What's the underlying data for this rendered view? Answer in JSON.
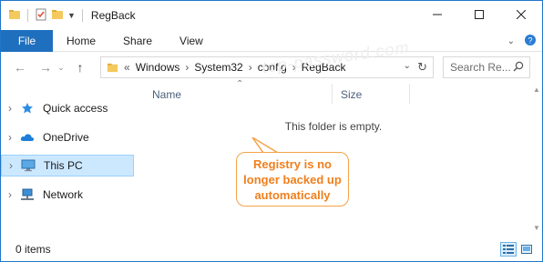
{
  "window": {
    "title": "RegBack"
  },
  "ribbon": {
    "tabs": [
      "File",
      "Home",
      "Share",
      "View"
    ]
  },
  "address": {
    "overflow": "«",
    "crumbs": [
      "Windows",
      "System32",
      "config",
      "RegBack"
    ]
  },
  "search": {
    "placeholder": "Search Re..."
  },
  "navpane": {
    "items": [
      {
        "label": "Quick access",
        "icon": "star-icon"
      },
      {
        "label": "OneDrive",
        "icon": "cloud-icon"
      },
      {
        "label": "This PC",
        "icon": "computer-icon",
        "selected": true
      },
      {
        "label": "Network",
        "icon": "network-icon"
      }
    ]
  },
  "content": {
    "columns": [
      "Name",
      "Size"
    ],
    "empty_message": "This folder is empty."
  },
  "callout": {
    "text": "Registry is no longer backed up automatically"
  },
  "watermark": {
    "text": "top-password.com"
  },
  "status": {
    "items": "0 items"
  },
  "colors": {
    "accent": "#1f6fbf",
    "callout": "#f07f1c",
    "selected": "#cce8ff"
  }
}
